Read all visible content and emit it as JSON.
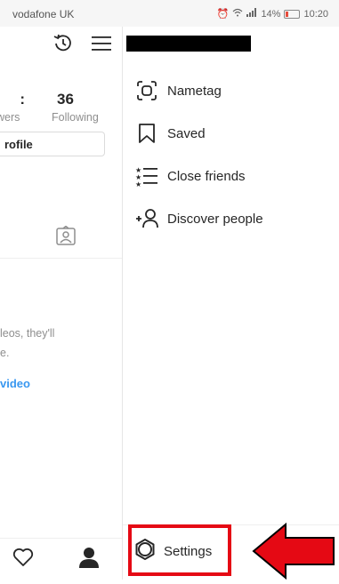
{
  "status_bar": {
    "carrier": "vodafone UK",
    "battery_level": "14%",
    "time": "10:20"
  },
  "profile": {
    "followers_count_fragment": ":",
    "following_count": "36",
    "followers_label_fragment": "wers",
    "following_label": "Following",
    "edit_profile_fragment": "rofile",
    "empty_text_line1": "leos, they'll",
    "empty_text_line2": "e.",
    "video_link_fragment": "video"
  },
  "drawer": {
    "items": [
      {
        "label": "Nametag",
        "icon": "nametag-icon"
      },
      {
        "label": "Saved",
        "icon": "bookmark-icon"
      },
      {
        "label": "Close friends",
        "icon": "close-friends-icon"
      },
      {
        "label": "Discover people",
        "icon": "add-person-icon"
      }
    ],
    "settings_label": "Settings"
  },
  "colors": {
    "highlight": "#e50914",
    "link": "#3897f0",
    "arrow": "#e50914"
  }
}
